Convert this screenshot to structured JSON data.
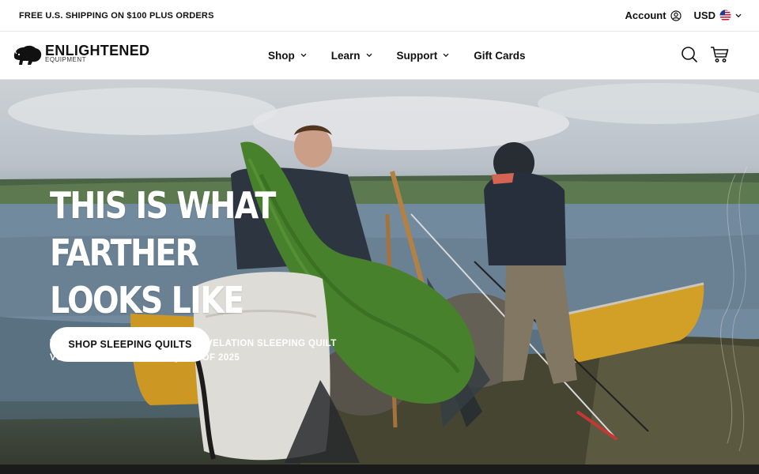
{
  "announcement": {
    "text": "FREE U.S. SHIPPING ON $100 PLUS ORDERS",
    "account_label": "Account",
    "currency_label": "USD",
    "account_icon": "user-circle-icon",
    "flag_icon": "us-flag-icon"
  },
  "header": {
    "logo_word": "ENLIGHTENED",
    "logo_sub": "EQUIPMENT",
    "nav": [
      {
        "label": "Shop"
      },
      {
        "label": "Learn"
      },
      {
        "label": "Support"
      },
      {
        "label": "Gift Cards"
      }
    ],
    "icons": [
      "search-icon",
      "cart-icon"
    ]
  },
  "hero": {
    "title_line1": "THIS IS WHAT FARTHER",
    "title_line2": "LOOKS LIKE",
    "subtitle_line1": "TACKLE THE TRAIL WITH THE REVELATION SLEEPING QUILT",
    "subtitle_line2": "VOTED THE TREKS BEST QUILT OF 2025",
    "cta_label": "SHOP SLEEPING QUILTS"
  },
  "colors": {
    "text": "#111111",
    "quilt_green": "#4d8a2e",
    "canoe_yellow": "#e0a92a",
    "cta_bg": "#ffffff"
  }
}
